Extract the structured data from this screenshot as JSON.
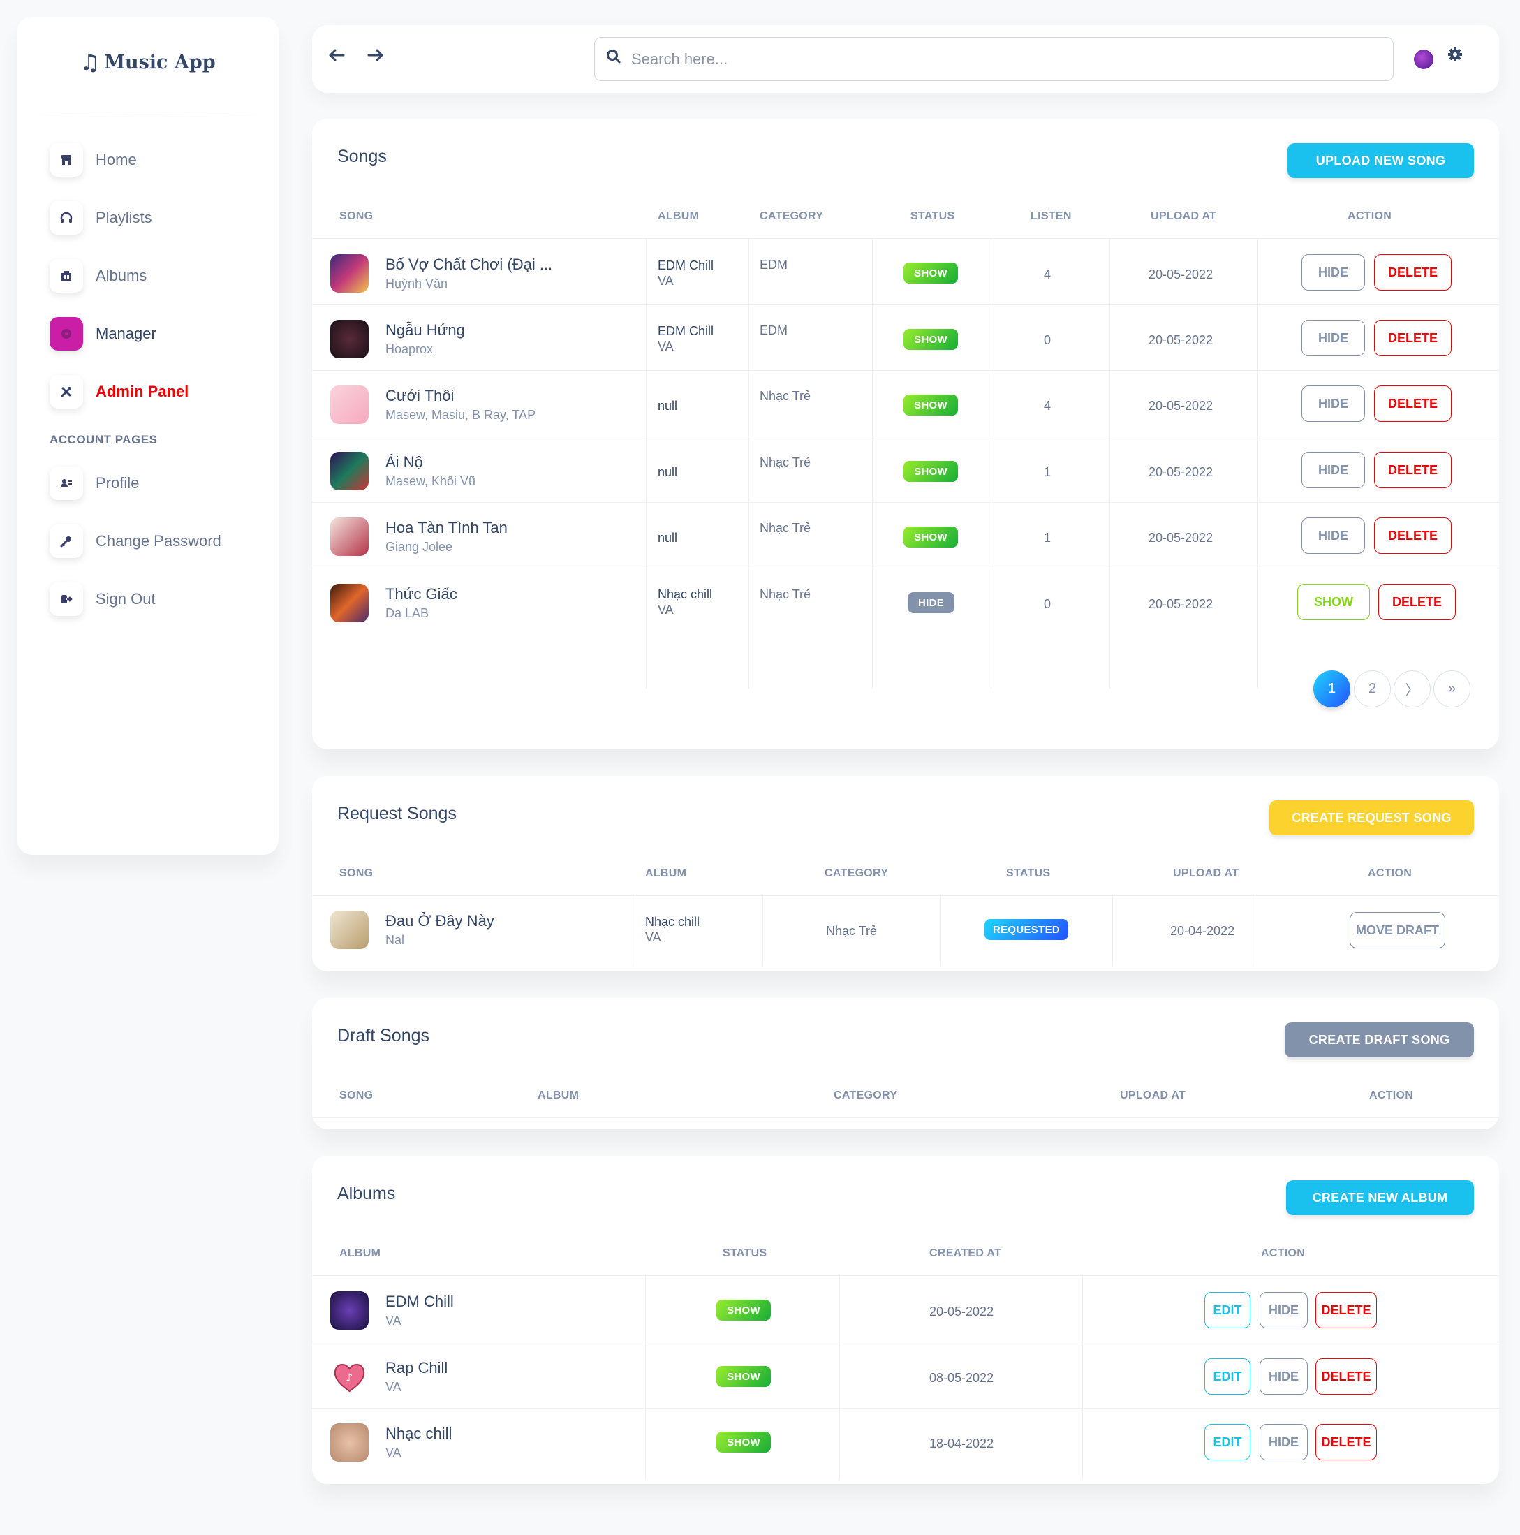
{
  "brand": {
    "icon": "music-note-icon",
    "name": "Music App"
  },
  "sidebar": {
    "items": [
      {
        "label": "Home",
        "icon": "shop-icon"
      },
      {
        "label": "Playlists",
        "icon": "headphones-icon"
      },
      {
        "label": "Albums",
        "icon": "album-icon"
      },
      {
        "label": "Manager",
        "icon": "disc-icon"
      },
      {
        "label": "Admin Panel",
        "icon": "tools-icon"
      }
    ],
    "section_label": "ACCOUNT PAGES",
    "account_items": [
      {
        "label": "Profile",
        "icon": "profile-icon"
      },
      {
        "label": "Change Password",
        "icon": "key-icon"
      },
      {
        "label": "Sign Out",
        "icon": "sign-out-icon"
      }
    ]
  },
  "topbar": {
    "search_placeholder": "Search here..."
  },
  "songs": {
    "title": "Songs",
    "button": "UPLOAD NEW SONG",
    "headers": [
      "SONG",
      "ALBUM",
      "CATEGORY",
      "STATUS",
      "LISTEN",
      "UPLOAD AT",
      "ACTION"
    ],
    "rows": [
      {
        "title": "Bố Vợ Chất Chơi (Đại ...",
        "artist": "Huỳnh Văn",
        "album": "EDM Chill",
        "album_artist": "VA",
        "category": "EDM",
        "status": "SHOW",
        "listen": "4",
        "upload": "20-05-2022",
        "toggle": "HIDE",
        "delete": "DELETE"
      },
      {
        "title": "Ngẫu Hứng",
        "artist": "Hoaprox",
        "album": "EDM Chill",
        "album_artist": "VA",
        "category": "EDM",
        "status": "SHOW",
        "listen": "0",
        "upload": "20-05-2022",
        "toggle": "HIDE",
        "delete": "DELETE"
      },
      {
        "title": "Cưới Thôi",
        "artist": "Masew, Masiu, B Ray, TAP",
        "album": "null",
        "album_artist": "",
        "category": "Nhạc Trẻ",
        "status": "SHOW",
        "listen": "4",
        "upload": "20-05-2022",
        "toggle": "HIDE",
        "delete": "DELETE"
      },
      {
        "title": "Ái Nộ",
        "artist": "Masew, Khôi Vũ",
        "album": "null",
        "album_artist": "",
        "category": "Nhạc Trẻ",
        "status": "SHOW",
        "listen": "1",
        "upload": "20-05-2022",
        "toggle": "HIDE",
        "delete": "DELETE"
      },
      {
        "title": "Hoa Tàn Tình Tan",
        "artist": "Giang Jolee",
        "album": "null",
        "album_artist": "",
        "category": "Nhạc Trẻ",
        "status": "SHOW",
        "listen": "1",
        "upload": "20-05-2022",
        "toggle": "HIDE",
        "delete": "DELETE"
      },
      {
        "title": "Thức Giấc",
        "artist": "Da LAB",
        "album": "Nhạc chill",
        "album_artist": "VA",
        "category": "Nhạc Trẻ",
        "status": "HIDE",
        "listen": "0",
        "upload": "20-05-2022",
        "toggle": "SHOW",
        "delete": "DELETE"
      }
    ],
    "pagination": [
      "1",
      "2",
      "〉",
      "»"
    ]
  },
  "requests": {
    "title": "Request Songs",
    "button": "CREATE REQUEST SONG",
    "headers": [
      "SONG",
      "ALBUM",
      "CATEGORY",
      "STATUS",
      "UPLOAD AT",
      "ACTION"
    ],
    "rows": [
      {
        "title": "Đau Ở Đây Này",
        "artist": "Nal",
        "album": "Nhạc chill",
        "album_artist": "VA",
        "category": "Nhạc Trẻ",
        "status": "REQUESTED",
        "upload": "20-04-2022",
        "action": "MOVE DRAFT"
      }
    ]
  },
  "drafts": {
    "title": "Draft Songs",
    "button": "CREATE DRAFT SONG",
    "headers": [
      "SONG",
      "ALBUM",
      "CATEGORY",
      "UPLOAD AT",
      "ACTION"
    ]
  },
  "albums": {
    "title": "Albums",
    "button": "CREATE NEW ALBUM",
    "headers": [
      "ALBUM",
      "STATUS",
      "CREATED AT",
      "ACTION"
    ],
    "rows": [
      {
        "title": "EDM Chill",
        "artist": "VA",
        "status": "SHOW",
        "created": "20-05-2022",
        "edit": "EDIT",
        "hide": "HIDE",
        "delete": "DELETE"
      },
      {
        "title": "Rap Chill",
        "artist": "VA",
        "status": "SHOW",
        "created": "08-05-2022",
        "edit": "EDIT",
        "hide": "HIDE",
        "delete": "DELETE"
      },
      {
        "title": "Nhạc chill",
        "artist": "VA",
        "status": "SHOW",
        "created": "18-04-2022",
        "edit": "EDIT",
        "hide": "HIDE",
        "delete": "DELETE"
      }
    ]
  }
}
